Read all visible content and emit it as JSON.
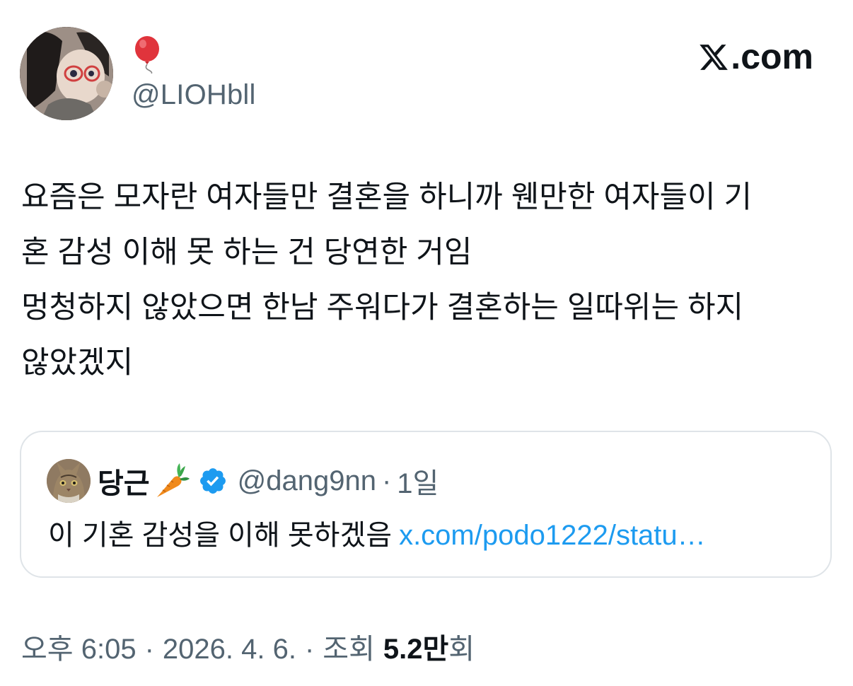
{
  "brand": {
    "label": ".com",
    "icon": "x-logo-icon"
  },
  "author": {
    "display_name_emoji": "balloon-icon",
    "handle": "@LIOHbll",
    "avatar": "profile-avatar"
  },
  "tweet": {
    "lines": [
      "요즘은 모자란 여자들만 결혼을 하니까 웬만한 여자들이 기",
      "혼 감성 이해 못 하는 건 당연한 거임",
      "멍청하지 않았으면 한남 주워다가 결혼하는 일따위는 하지",
      "않았겠지"
    ]
  },
  "quote": {
    "name": "당근",
    "name_emoji": "carrot-icon",
    "verified_icon": "verified-badge-icon",
    "handle": "@dang9nn",
    "separator": "·",
    "time": "1일",
    "text": "이 기혼 감성을 이해 못하겠음",
    "link": "x.com/podo1222/statu…"
  },
  "footer": {
    "time": "오후 6:05",
    "sep1": "·",
    "date": "2026. 4. 6.",
    "sep2": "·",
    "views_label": "조회",
    "views_number": "5.2만",
    "views_suffix": "회"
  },
  "colors": {
    "text": "#0f1419",
    "secondary": "#536471",
    "link": "#1d9bf0",
    "border": "#dfe4e8",
    "verified": "#1d9bf0"
  }
}
